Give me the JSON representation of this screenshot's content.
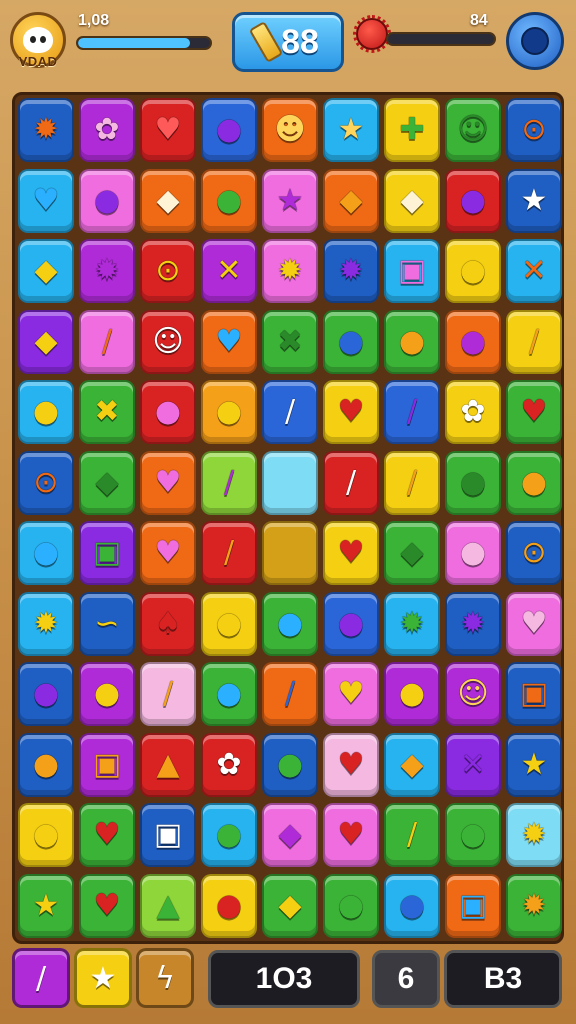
{
  "hud": {
    "player": {
      "name": "VDAD",
      "score": "1,08",
      "bar_level": 0.85,
      "bar_color": "#4fc3ff"
    },
    "moves": {
      "value": "88"
    },
    "enemy": {
      "score": "84",
      "bar_level": 0.0,
      "bar_color": "#e53935"
    },
    "icons": {
      "avatar": "cat-face-icon",
      "moves": "stick-icon",
      "enemy": "spiky-red-orb-icon",
      "booster": "blue-orb-icon"
    }
  },
  "board": {
    "cols": 9,
    "rows": 12,
    "empty_cells": [
      [
        5,
        4
      ]
    ],
    "colors": [
      [
        "#1f5fc4",
        "#b02bd8",
        "#d92323",
        "#2a66d8",
        "#f06a16",
        "#27b3f0",
        "#f5cf12",
        "#3bb337",
        "#1f5fc4"
      ],
      [
        "#27b3f0",
        "#f06de0",
        "#f06a16",
        "#f06a16",
        "#f06de0",
        "#f06a16",
        "#f5cf12",
        "#d92323",
        "#1f5fc4"
      ],
      [
        "#27b3f0",
        "#b02bd8",
        "#d92323",
        "#b02bd8",
        "#f06de0",
        "#1f5fc4",
        "#27b3f0",
        "#f5cf12",
        "#27b3f0"
      ],
      [
        "#8a2be2",
        "#f06de0",
        "#d92323",
        "#f06a16",
        "#3bb337",
        "#3bb337",
        "#3bb337",
        "#f06a16",
        "#f5cf12"
      ],
      [
        "#27b3f0",
        "#3bb337",
        "#d92323",
        "#f5a019",
        "#2a66d8",
        "#f5cf12",
        "#2a66d8",
        "#f5cf12",
        "#3bb337"
      ],
      [
        "#1f5fc4",
        "#3bb337",
        "#f06a16",
        "#8ed63a",
        "#7fdcf5",
        "#d92323",
        "#f5cf12",
        "#3bb337",
        "#3bb337"
      ],
      [
        "#27b3f0",
        "#8a2be2",
        "#f06a16",
        "#d92323",
        "#d4a017",
        "#f5cf12",
        "#3bb337",
        "#f06de0",
        "#1f5fc4"
      ],
      [
        "#27b3f0",
        "#1f5fc4",
        "#d92323",
        "#f5cf12",
        "#3bb337",
        "#2a66d8",
        "#27b3f0",
        "#1f5fc4",
        "#f06de0"
      ],
      [
        "#1f5fc4",
        "#b02bd8",
        "#f5b8e0",
        "#3bb337",
        "#f06a16",
        "#f06de0",
        "#b02bd8",
        "#b02bd8",
        "#1f5fc4"
      ],
      [
        "#1f5fc4",
        "#b02bd8",
        "#d92323",
        "#d92323",
        "#1f5fc4",
        "#f5b8e0",
        "#27b3f0",
        "#8a2be2",
        "#1f5fc4"
      ],
      [
        "#f5cf12",
        "#3bb337",
        "#1f5fc4",
        "#27b3f0",
        "#f06de0",
        "#f06de0",
        "#3bb337",
        "#3bb337",
        "#7fdcf5"
      ],
      [
        "#3bb337",
        "#3bb337",
        "#8ed63a",
        "#f5cf12",
        "#3bb337",
        "#3bb337",
        "#27b3f0",
        "#f06a16",
        "#3bb337"
      ]
    ],
    "glyphs": [
      [
        "✹",
        "✿",
        "♥",
        "●",
        "☻",
        "★",
        "✚",
        "☺",
        "⊙"
      ],
      [
        "♥",
        "●",
        "◆",
        "●",
        "★",
        "◆",
        "◆",
        "●",
        "★"
      ],
      [
        "◆",
        "✹",
        "⊙",
        "✕",
        "✹",
        "✹",
        "▣",
        "●",
        "✕"
      ],
      [
        "◆",
        "/",
        "☺",
        "♥",
        "✖",
        "●",
        "●",
        "●",
        "/"
      ],
      [
        "●",
        "✖",
        "●",
        "●",
        "/",
        "♥",
        "/",
        "✿",
        "♥"
      ],
      [
        "⊙",
        "◆",
        "♥",
        "/",
        "",
        "/",
        "/",
        "●",
        "●"
      ],
      [
        "●",
        "▣",
        "♥",
        "/",
        "",
        "♥",
        "◆",
        "●",
        "⊙"
      ],
      [
        "✹",
        "∽",
        "♠",
        "●",
        "●",
        "●",
        "✹",
        "✹",
        "♥"
      ],
      [
        "●",
        "●",
        "/",
        "●",
        "/",
        "♥",
        "●",
        "☺",
        "▣"
      ],
      [
        "●",
        "▣",
        "▲",
        "✿",
        "●",
        "♥",
        "◆",
        "✕",
        "★"
      ],
      [
        "●",
        "♥",
        "▣",
        "●",
        "◆",
        "♥",
        "/",
        "●",
        "✹"
      ],
      [
        "★",
        "♥",
        "▲",
        "●",
        "◆",
        "●",
        "●",
        "▣",
        "✹"
      ]
    ],
    "glyph_colors": [
      [
        "#f06a16",
        "#f5b8e0",
        "#ff5a5a",
        "#8a2be2",
        "#ffd45a",
        "#ffd45a",
        "#3bb337",
        "#2a8a2a",
        "#f06a16"
      ],
      [
        "#2ab0ff",
        "#8a2be2",
        "#fff3d6",
        "#3bb337",
        "#b02bd8",
        "#f5a019",
        "#fff3d6",
        "#8a2be2",
        "#ffffff"
      ],
      [
        "#f5cf12",
        "#b02bd8",
        "#f5cf12",
        "#f5cf12",
        "#f5cf12",
        "#8a2be2",
        "#f06de0",
        "#f5cf12",
        "#f06a16"
      ],
      [
        "#f5cf12",
        "#f06a16",
        "#ffffff",
        "#2ab0ff",
        "#2a8a2a",
        "#2a66d8",
        "#f5a019",
        "#b02bd8",
        "#f5a019"
      ],
      [
        "#f5cf12",
        "#f5cf12",
        "#f06de0",
        "#f5cf12",
        "#ffffff",
        "#d92323",
        "#8a2be2",
        "#ffffff",
        "#d92323"
      ],
      [
        "#f06a16",
        "#2a8a2a",
        "#f06de0",
        "#b02bd8",
        "",
        "#ffffff",
        "#f5a019",
        "#2a8a2a",
        "#f5a019"
      ],
      [
        "#2ab0ff",
        "#3bb337",
        "#f06de0",
        "#f5a019",
        "",
        "#d92323",
        "#2a8a2a",
        "#f5b8e0",
        "#f5a019"
      ],
      [
        "#f5cf12",
        "#f5cf12",
        "#d92323",
        "#f5cf12",
        "#2ab0ff",
        "#8a2be2",
        "#3bb337",
        "#8a2be2",
        "#f5b8e0"
      ],
      [
        "#8a2be2",
        "#f5cf12",
        "#f5a019",
        "#2ab0ff",
        "#2a66d8",
        "#f5cf12",
        "#f5cf12",
        "#ffd45a",
        "#f06a16"
      ],
      [
        "#f5a019",
        "#f5a019",
        "#f5a019",
        "#ffffff",
        "#3bb337",
        "#d92323",
        "#f5a019",
        "#8a2be2",
        "#f5cf12"
      ],
      [
        "#f5cf12",
        "#d92323",
        "#ffffff",
        "#3bb337",
        "#b02bd8",
        "#d92323",
        "#f5cf12",
        "#3bb337",
        "#f5cf12"
      ],
      [
        "#f5cf12",
        "#d92323",
        "#3bb337",
        "#d92323",
        "#f5cf12",
        "#3bb337",
        "#2a66d8",
        "#2ab0ff",
        "#f5a019"
      ]
    ]
  },
  "bottom_bar": {
    "boosters": [
      {
        "icon": "stick-icon",
        "glyph": "/",
        "color": "#b02bd8"
      },
      {
        "icon": "star-icon",
        "glyph": "★",
        "color": "#f5cf12"
      },
      {
        "icon": "lightning-icon",
        "glyph": "ϟ",
        "color": "#c8862a"
      }
    ],
    "counters": [
      "1O3",
      "6",
      "B3"
    ]
  }
}
